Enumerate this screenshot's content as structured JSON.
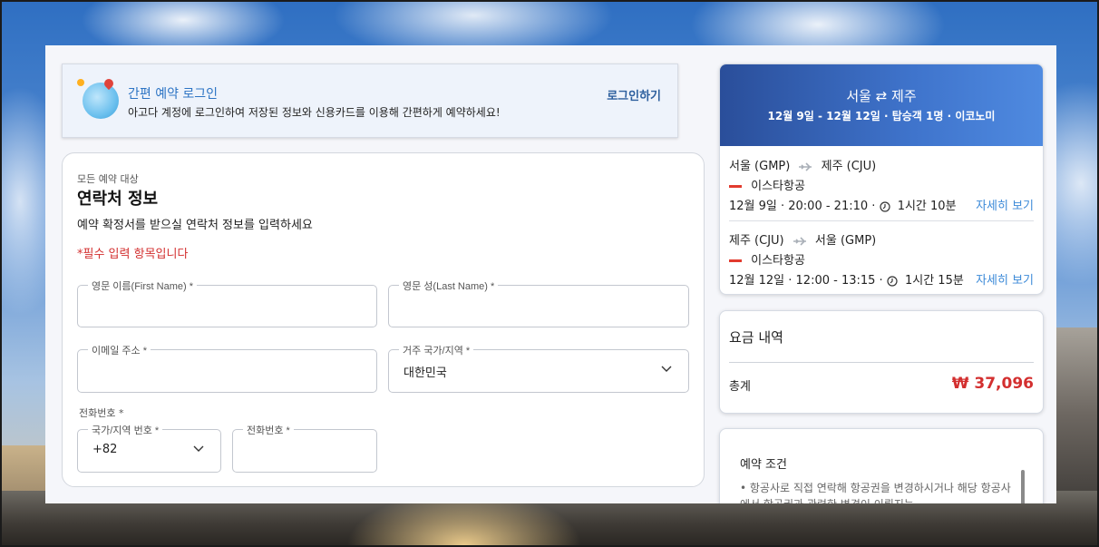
{
  "login_banner": {
    "title": "간편 예약 로그인",
    "description": "아고다 계정에 로그인하여 저장된 정보와 신용카드를 이용해 간편하게 예약하세요!",
    "link": "로그인하기"
  },
  "contact": {
    "eyebrow": "모든 예약 대상",
    "title": "연락처 정보",
    "subtitle": "예약 확정서를 받으실 연락처 정보를 입력하세요",
    "required_note": "*필수 입력 항목입니다",
    "fields": {
      "first_name": {
        "label": "영문 이름(First Name) *",
        "value": ""
      },
      "last_name": {
        "label": "영문 성(Last Name) *",
        "value": ""
      },
      "email": {
        "label": "이메일 주소 *",
        "value": ""
      },
      "country": {
        "label": "거주 국가/지역 *",
        "value": "대한민국"
      },
      "phone_group_label": "전화번호 *",
      "country_code": {
        "label": "국가/지역 번호 *",
        "value": "+82"
      },
      "phone": {
        "label": "전화번호 *",
        "value": ""
      }
    }
  },
  "flight": {
    "route": "서울 ⇄ 제주",
    "trip_info": "12월 9일 - 12월 12일 · 탑승객 1명 · 이코노미",
    "legs": [
      {
        "from": "서울 (GMP)",
        "to": "제주 (CJU)",
        "airline": "이스타항공",
        "time": "12월 9일 · 20:00 - 21:10 ·",
        "duration": "1시간 10분",
        "detail_link": "자세히 보기"
      },
      {
        "from": "제주 (CJU)",
        "to": "서울 (GMP)",
        "airline": "이스타항공",
        "time": "12월 12일 · 12:00 - 13:15 ·",
        "duration": "1시간 15분",
        "detail_link": "자세히 보기"
      }
    ]
  },
  "fare": {
    "title": "요금 내역",
    "total_label": "총계",
    "total_value": "₩ 37,096"
  },
  "terms": {
    "title": "예약 조건",
    "text": "• 항공사로 직접 연락해 항공권을 변경하시거나 해당 항공사에서 항공권과 관련한 변경이 이뤄지는"
  },
  "colors": {
    "accent": "#2d74c4",
    "link": "#3c8ad8",
    "required": "#d32f2f",
    "header_gradient_start": "#2a4e9a",
    "header_gradient_end": "#4f8ae0"
  }
}
